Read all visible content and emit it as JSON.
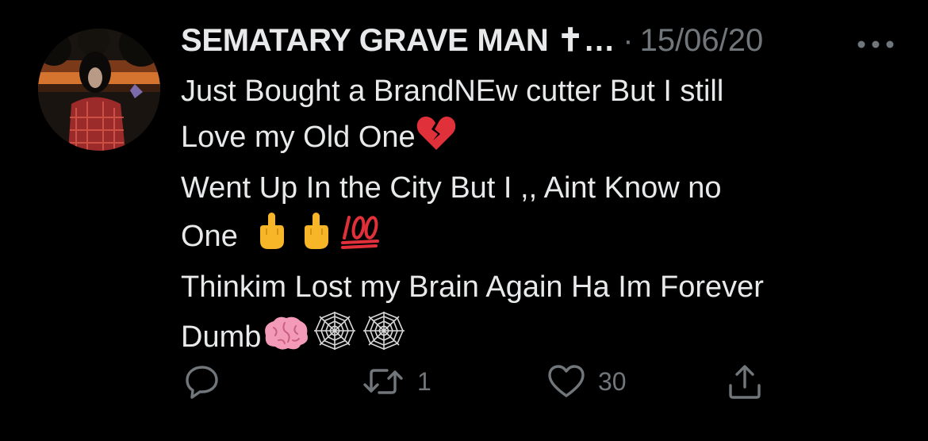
{
  "tweet": {
    "author_name": "SEMATARY GRAVE MAN ✝…",
    "separator": "·",
    "date": "15/06/20",
    "more_icon": "more-horizontal-icon",
    "lines": [
      "Just Bought a BrandNEw cutter But I still",
      "Love my Old One",
      "Went Up In the City But I ,, Aint Know no",
      "One",
      "Thinkim Lost my Brain Again Ha Im Forever",
      "Dumb"
    ],
    "emojis": {
      "broken_heart": "broken-heart-emoji",
      "middle_finger": "middle-finger-emoji",
      "hundred": "hundred-points-emoji",
      "brain": "brain-emoji",
      "spider_web": "spider-web-emoji"
    }
  },
  "actions": {
    "reply": {
      "icon": "reply-icon",
      "count": ""
    },
    "retweet": {
      "icon": "retweet-icon",
      "count": "1"
    },
    "like": {
      "icon": "heart-icon",
      "count": "30"
    },
    "share": {
      "icon": "share-icon",
      "count": ""
    }
  },
  "colors": {
    "background": "#000000",
    "primary_text": "#e7e9ea",
    "secondary_text": "#71767b"
  }
}
